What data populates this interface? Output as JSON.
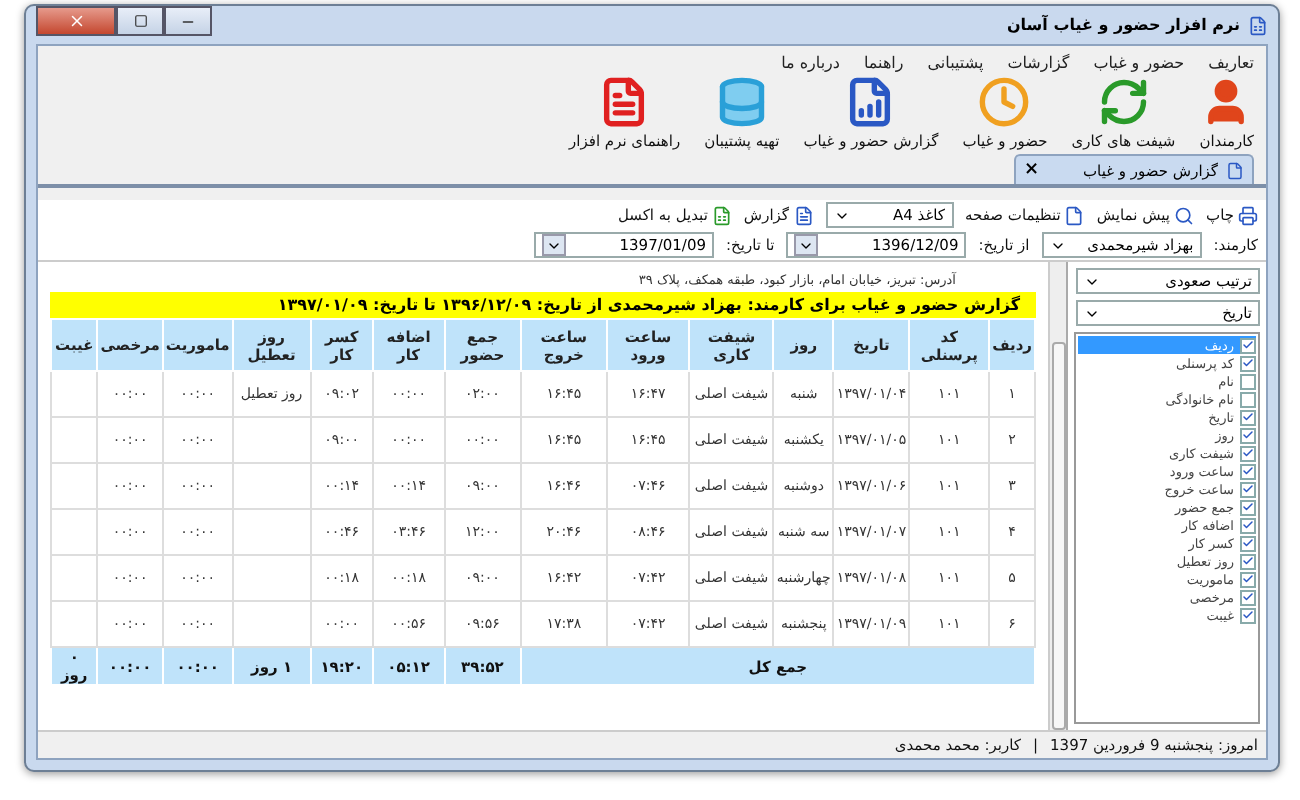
{
  "window": {
    "title": "نرم افزار حضور و غیاب آسان"
  },
  "menu": [
    "تعاریف",
    "حضور و غیاب",
    "گزارشات",
    "پشتیبانی",
    "راهنما",
    "درباره ما"
  ],
  "ribbon": [
    {
      "kind": "person",
      "label": "کارمندان"
    },
    {
      "kind": "cycle",
      "label": "شیفت های کاری"
    },
    {
      "kind": "clock",
      "label": "حضور و غیاب"
    },
    {
      "kind": "chart",
      "label": "گزارش حضور و غیاب"
    },
    {
      "kind": "database",
      "label": "تهیه پشتیبان"
    },
    {
      "kind": "pdf",
      "label": "راهنمای نرم افزار"
    }
  ],
  "tabs": [
    {
      "label": "گزارش حضور و غیاب",
      "selected": true,
      "close": "×"
    }
  ],
  "report_toolbar": {
    "print": "چاپ",
    "preview": "پیش نمایش",
    "page_setup": "تنظیمات صفحه",
    "paper": "کاغذ A4",
    "report": "گزارش",
    "excel": "تبدیل به اکسل"
  },
  "filters": {
    "employee_label": "کارمند:",
    "employee": "بهزاد شیرمحمدی",
    "from_label": "از تاریخ:",
    "from": "1396/12/09",
    "to_label": "تا تاریخ:",
    "to": "1397/01/09"
  },
  "report": {
    "address": "آدرس: تبریز، خیابان امام، بازار کبود، طبقه همکف، پلاک ۳۹",
    "title": "گزارش حضور و غیاب برای کارمند: بهزاد شیرمحمدی از تاریخ: ۱۳۹۶/۱۲/۰۹ تا تاریخ: ۱۳۹۷/۰۱/۰۹",
    "columns": [
      "ردیف",
      "کد پرسنلی",
      "تاریخ",
      "روز",
      "شیفت کاری",
      "ساعت ورود",
      "ساعت خروج",
      "جمع حضور",
      "اضافه کار",
      "کسر کار",
      "روز تعطیل",
      "ماموریت",
      "مرخصی",
      "غیبت"
    ],
    "rows": [
      [
        "۱",
        "۱۰۱",
        "۱۳۹۷/۰۱/۰۴",
        "شنبه",
        "شیفت اصلی",
        "۱۶:۴۷",
        "۱۶:۴۵",
        "۰۲:۰۰",
        "۰۰:۰۰",
        "۰۹:۰۲",
        "روز تعطیل",
        "۰۰:۰۰",
        "۰۰:۰۰",
        null
      ],
      [
        "۲",
        "۱۰۱",
        "۱۳۹۷/۰۱/۰۵",
        "یکشنبه",
        "شیفت اصلی",
        "۱۶:۴۵",
        "۱۶:۴۵",
        "۰۰:۰۰",
        "۰۰:۰۰",
        "۰۹:۰۰",
        null,
        "۰۰:۰۰",
        "۰۰:۰۰",
        null
      ],
      [
        "۳",
        "۱۰۱",
        "۱۳۹۷/۰۱/۰۶",
        "دوشنبه",
        "شیفت اصلی",
        "۰۷:۴۶",
        "۱۶:۴۶",
        "۰۹:۰۰",
        "۰۰:۱۴",
        "۰۰:۱۴",
        null,
        "۰۰:۰۰",
        "۰۰:۰۰",
        null
      ],
      [
        "۴",
        "۱۰۱",
        "۱۳۹۷/۰۱/۰۷",
        "سه شنبه",
        "شیفت اصلی",
        "۰۸:۴۶",
        "۲۰:۴۶",
        "۱۲:۰۰",
        "۰۳:۴۶",
        "۰۰:۴۶",
        null,
        "۰۰:۰۰",
        "۰۰:۰۰",
        null
      ],
      [
        "۵",
        "۱۰۱",
        "۱۳۹۷/۰۱/۰۸",
        "چهارشنبه",
        "شیفت اصلی",
        "۰۷:۴۲",
        "۱۶:۴۲",
        "۰۹:۰۰",
        "۰۰:۱۸",
        "۰۰:۱۸",
        null,
        "۰۰:۰۰",
        "۰۰:۰۰",
        null
      ],
      [
        "۶",
        "۱۰۱",
        "۱۳۹۷/۰۱/۰۹",
        "پنجشنبه",
        "شیفت اصلی",
        "۰۷:۴۲",
        "۱۷:۳۸",
        "۰۹:۵۶",
        "۰۰:۵۶",
        "۰۰:۰۰",
        null,
        "۰۰:۰۰",
        "۰۰:۰۰",
        null
      ]
    ],
    "total_label": "جمع کل",
    "totals": [
      "۳۹:۵۲",
      "۰۵:۱۲",
      "۱۹:۲۰",
      "۱ روز",
      "۰۰:۰۰",
      "۰۰:۰۰",
      "۰ روز"
    ]
  },
  "sidebar": {
    "sort_order": "ترتیب صعودی",
    "sort_field": "تاریخ",
    "fields": [
      {
        "label": "ردیف",
        "checked": true,
        "selected": true
      },
      {
        "label": "کد پرسنلی",
        "checked": true,
        "selected": false
      },
      {
        "label": "نام",
        "checked": false,
        "selected": false
      },
      {
        "label": "نام خانوادگی",
        "checked": false,
        "selected": false
      },
      {
        "label": "تاریخ",
        "checked": true,
        "selected": false
      },
      {
        "label": "روز",
        "checked": true,
        "selected": false
      },
      {
        "label": "شیفت کاری",
        "checked": true,
        "selected": false
      },
      {
        "label": "ساعت ورود",
        "checked": true,
        "selected": false
      },
      {
        "label": "ساعت خروج",
        "checked": true,
        "selected": false
      },
      {
        "label": "جمع حضور",
        "checked": true,
        "selected": false
      },
      {
        "label": "اضافه کار",
        "checked": true,
        "selected": false
      },
      {
        "label": "کسر کار",
        "checked": true,
        "selected": false
      },
      {
        "label": "روز تعطیل",
        "checked": true,
        "selected": false
      },
      {
        "label": "ماموریت",
        "checked": true,
        "selected": false
      },
      {
        "label": "مرخصی",
        "checked": true,
        "selected": false
      },
      {
        "label": "غیبت",
        "checked": true,
        "selected": false
      }
    ]
  },
  "status_bar": {
    "today": "امروز: پنجشنبه 9 فروردین 1397",
    "separator": "|",
    "user": "کاربر: محمد محمدی"
  }
}
